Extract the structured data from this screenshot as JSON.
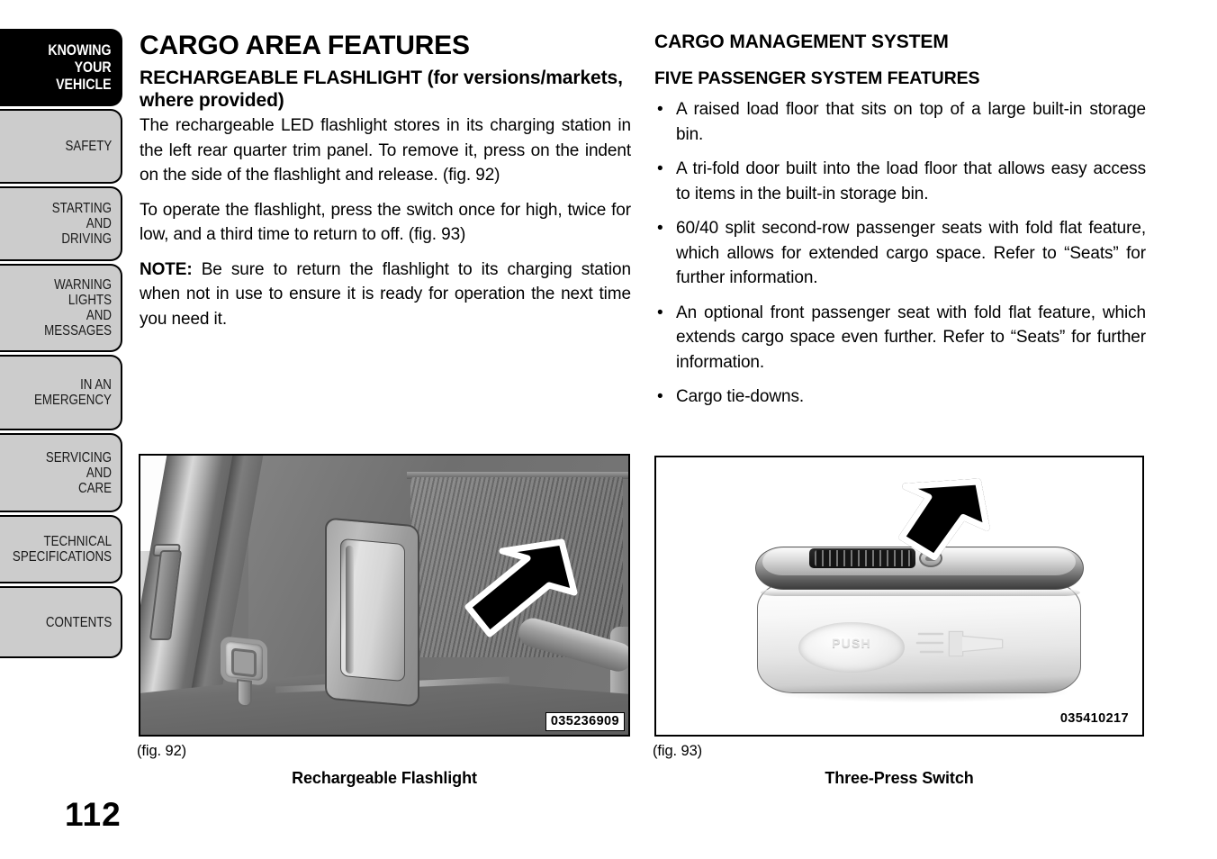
{
  "sidebar": {
    "tabs": [
      {
        "label": "KNOWING\nYOUR\nVEHICLE",
        "active": true
      },
      {
        "label": "SAFETY",
        "active": false
      },
      {
        "label": "STARTING\nAND\nDRIVING",
        "active": false
      },
      {
        "label": "WARNING\nLIGHTS\nAND\nMESSAGES",
        "active": false
      },
      {
        "label": "IN AN\nEMERGENCY",
        "active": false
      },
      {
        "label": "SERVICING\nAND\nCARE",
        "active": false
      },
      {
        "label": "TECHNICAL\nSPECIFICATIONS",
        "active": false
      },
      {
        "label": "CONTENTS",
        "active": false
      }
    ]
  },
  "page_number": "112",
  "left_column": {
    "title": "CARGO AREA FEATURES",
    "section_heading_bold": "RECHARGEABLE FLASHLIGHT ",
    "section_heading_rest": "(for versions/markets, where provided)",
    "paragraph_1": "The rechargeable LED flashlight stores in its charging station in the left rear quarter trim panel. To remove it, press on the indent on the side of the flashlight and release.  (fig.  92)",
    "paragraph_2": "To operate the flashlight, press the switch once for high, twice for low, and a third time to return to off. (fig.  93)",
    "note_label": "NOTE:",
    "note_text": "  Be sure to return the flashlight to its charging station when not in use to ensure it is ready for operation the next time you need it."
  },
  "right_column": {
    "heading_1": "CARGO MANAGEMENT SYSTEM",
    "heading_2": "FIVE PASSENGER SYSTEM FEATURES",
    "bullets": [
      "A raised load floor that sits on top of a large built-in storage bin.",
      "A tri-fold door built into the load floor that allows easy access to items in the built-in storage bin.",
      "60/40 split second-row passenger seats with fold flat feature, which allows for extended cargo space. Refer to “Seats” for further information.",
      "An optional front passenger seat with fold flat feature, which extends cargo space even further. Refer to “Seats” for further information.",
      "Cargo tie-downs."
    ]
  },
  "figures": {
    "left": {
      "number_label": "(fig. 92)",
      "caption": "Rechargeable Flashlight",
      "image_code": "035236909",
      "alt": "Rear quarter trim panel with flashlight charging station; arrow points at the flashlight indent"
    },
    "right": {
      "number_label": "(fig. 93)",
      "caption": "Three-Press Switch",
      "image_code": "035410217",
      "button_text": "PUSH",
      "alt": "Rechargeable flashlight showing the three-press switch; arrow points at the switch"
    }
  },
  "colors": {
    "tab_inactive_bg": "#cccccc",
    "tab_active_bg": "#000000",
    "tab_border": "#000000",
    "text": "#000000",
    "page_bg": "#ffffff"
  }
}
